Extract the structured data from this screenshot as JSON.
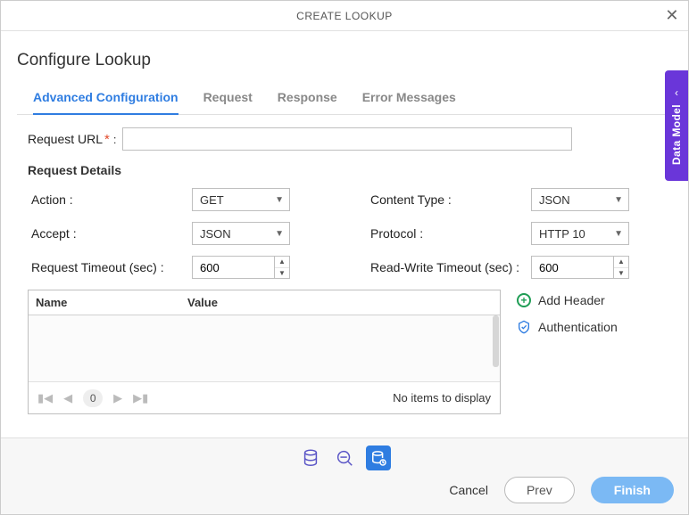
{
  "dialog": {
    "title": "CREATE LOOKUP"
  },
  "page": {
    "heading": "Configure Lookup"
  },
  "tabs": [
    {
      "label": "Advanced Configuration",
      "active": true
    },
    {
      "label": "Request",
      "active": false
    },
    {
      "label": "Response",
      "active": false
    },
    {
      "label": "Error Messages",
      "active": false
    }
  ],
  "form": {
    "request_url": {
      "label": "Request URL",
      "required": true,
      "value": ""
    },
    "section_heading": "Request Details",
    "action": {
      "label": "Action :",
      "value": "GET"
    },
    "content_type": {
      "label": "Content Type :",
      "value": "JSON"
    },
    "accept": {
      "label": "Accept :",
      "value": "JSON"
    },
    "protocol": {
      "label": "Protocol :",
      "value": "HTTP 10"
    },
    "request_timeout": {
      "label": "Request Timeout (sec) :",
      "value": "600"
    },
    "readwrite_timeout": {
      "label": "Read-Write Timeout (sec) :",
      "value": "600"
    }
  },
  "headers_table": {
    "columns": [
      "Name",
      "Value"
    ],
    "rows": [],
    "pager": {
      "page": "0",
      "empty_message": "No items to display"
    }
  },
  "side_actions": {
    "add_header": "Add Header",
    "authentication": "Authentication"
  },
  "footer": {
    "cancel": "Cancel",
    "prev": "Prev",
    "finish": "Finish"
  },
  "side_rail": {
    "label": "Data Model"
  },
  "colors": {
    "accent": "#2f7de1",
    "rail": "#6a36d9",
    "success": "#1f9d55"
  }
}
